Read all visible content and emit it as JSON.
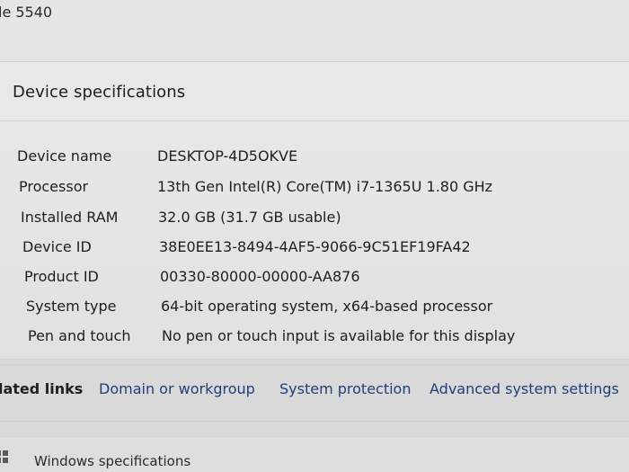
{
  "header": {
    "device_model_fragment": "le 5540"
  },
  "device_specifications": {
    "title": "Device specifications",
    "rows": [
      {
        "label": "Device name",
        "value": "DESKTOP-4D5OKVE"
      },
      {
        "label": "Processor",
        "value": "13th Gen Intel(R) Core(TM) i7-1365U   1.80 GHz"
      },
      {
        "label": "Installed RAM",
        "value": "32.0 GB (31.7 GB usable)"
      },
      {
        "label": "Device ID",
        "value": "38E0EE13-8494-4AF5-9066-9C51EF19FA42"
      },
      {
        "label": "Product ID",
        "value": "00330-80000-00000-AA876"
      },
      {
        "label": "System type",
        "value": "64-bit operating system, x64-based processor"
      },
      {
        "label": "Pen and touch",
        "value": "No pen or touch input is available for this display"
      }
    ]
  },
  "related_links": {
    "label": "lated links",
    "links": [
      {
        "label": "Domain or workgroup"
      },
      {
        "label": "System protection"
      },
      {
        "label": "Advanced system settings"
      }
    ]
  },
  "windows_specifications": {
    "label": "Windows specifications"
  },
  "colors": {
    "link": "#1f3f7a",
    "text": "#202020",
    "background": "#e3e3e3"
  }
}
